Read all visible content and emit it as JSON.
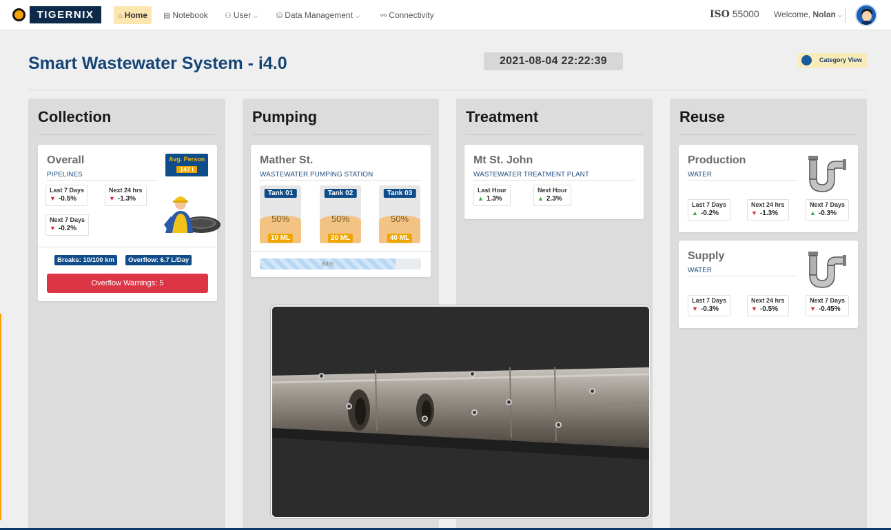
{
  "nav": {
    "brand": "TIGERNIX",
    "items": [
      {
        "label": "Home",
        "icon": "home-icon"
      },
      {
        "label": "Notebook",
        "icon": "notebook-icon"
      },
      {
        "label": "User",
        "icon": "users-icon"
      },
      {
        "label": "Data Management",
        "icon": "database-icon"
      },
      {
        "label": "Connectivity",
        "icon": "connectivity-icon"
      }
    ],
    "iso_prefix": "ISO",
    "iso_number": "55000",
    "welcome_prefix": "Welcome,",
    "user_name": "Nolan"
  },
  "header": {
    "title": "Smart Wastewater System - i4.0",
    "datetime": "2021-08-04  22:22:39",
    "category_view": "Category View"
  },
  "columns": {
    "collection": {
      "title": "Collection",
      "card": {
        "name": "Overall",
        "sub": "PIPELINES",
        "avg_label": "Avg. Person",
        "avg_value": "147 l",
        "stats": [
          {
            "label": "Last 7 Days",
            "value": "-0.5%",
            "trend": "down"
          },
          {
            "label": "Next 24 hrs",
            "value": "-1.3%",
            "trend": "down"
          },
          {
            "label": "Next 7 Days",
            "value": "-0.2%",
            "trend": "down"
          }
        ],
        "breaks": "Breaks: 10/100 km",
        "overflow": "Overflow: 6.7 L/Day",
        "warning_button": "Overflow Warnings: 5"
      }
    },
    "pumping": {
      "title": "Pumping",
      "card": {
        "name": "Mather St.",
        "sub": "WASTEWATER PUMPING STATION",
        "tanks": [
          {
            "label": "Tank 01",
            "level": "50%",
            "volume": "10 ML"
          },
          {
            "label": "Tank 02",
            "level": "50%",
            "volume": "20 ML"
          },
          {
            "label": "Tank 03",
            "level": "50%",
            "volume": "40 ML"
          }
        ],
        "progress_label": "84%",
        "progress_value": 0.84
      }
    },
    "treatment": {
      "title": "Treatment",
      "card": {
        "name": "Mt St. John",
        "sub": "WASTEWATER TREATMENT PLANT",
        "stats": [
          {
            "label": "Last Hour",
            "value": "1.3%",
            "trend": "up"
          },
          {
            "label": "Next Hour",
            "value": "2.3%",
            "trend": "up"
          }
        ]
      }
    },
    "reuse": {
      "title": "Reuse",
      "cards": [
        {
          "name": "Production",
          "sub": "WATER",
          "stats": [
            {
              "label": "Last 7 Days",
              "value": "-0.2%",
              "trend": "up"
            },
            {
              "label": "Next 24 hrs",
              "value": "-1.3%",
              "trend": "down"
            },
            {
              "label": "Next 7 Days",
              "value": "-0.3%",
              "trend": "up"
            }
          ]
        },
        {
          "name": "Supply",
          "sub": "WATER",
          "stats": [
            {
              "label": "Last 7 Days",
              "value": "-0.3%",
              "trend": "down"
            },
            {
              "label": "Next 24 hrs",
              "value": "-0.5%",
              "trend": "down"
            },
            {
              "label": "Next 7 Days",
              "value": "-0.45%",
              "trend": "down"
            }
          ]
        }
      ]
    }
  },
  "viewer": {
    "content": "pipe-3d-scan",
    "marker_count": 8
  },
  "colors": {
    "brand_navy": "#0f4c8a",
    "title_blue": "#154577",
    "accent_orange": "#f0a500",
    "warning_red": "#dc3545",
    "trend_up": "#2fa84f",
    "trend_down": "#d42a3c"
  }
}
